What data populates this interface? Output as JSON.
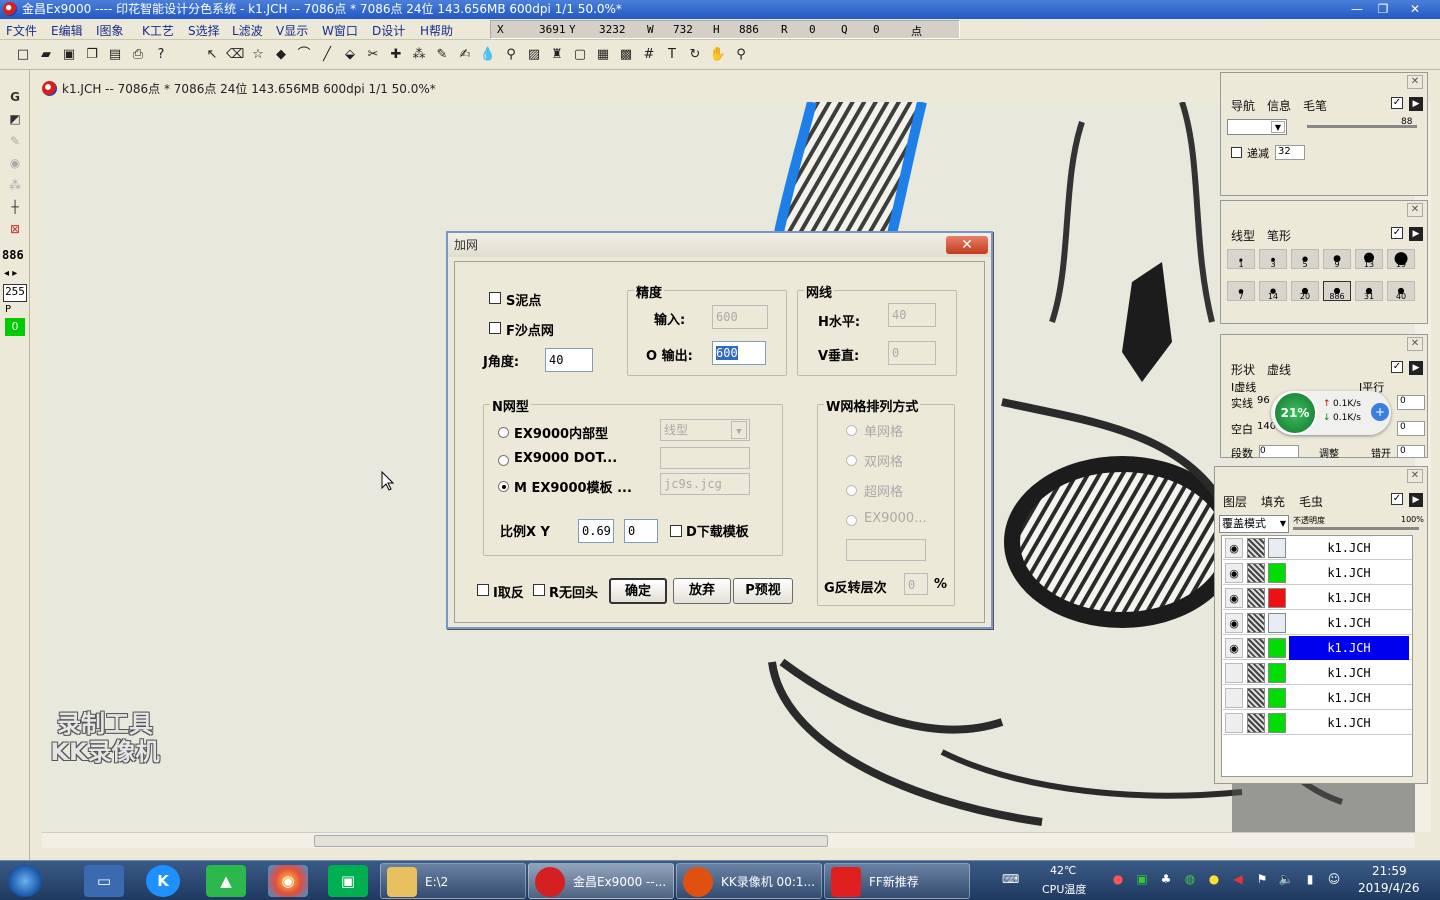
{
  "window": {
    "title": "金昌Ex9000 ---- 印花智能设计分色系统 - k1.JCH -- 7086点 * 7086点 24位 143.656MB 600dpi 1/1  50.0%*",
    "min": "—",
    "max": "❐",
    "close": "✕"
  },
  "menu": [
    "F文件",
    "E编辑",
    "I图象",
    "K工艺",
    "S选择",
    "L滤波",
    "V显示",
    "W窗口",
    "D设计",
    "H帮助"
  ],
  "coords": {
    "x_label": "X",
    "x": "3691",
    "y_label": "Y",
    "y": "3232",
    "w_label": "W",
    "w": "732",
    "h_label": "H",
    "h": "886",
    "r_label": "R",
    "r": "0",
    "q_label": "Q",
    "q": "0",
    "unit": "点"
  },
  "toolbox": {
    "g": "G",
    "num1": "886",
    "num2": "255",
    "tag": "P",
    "num3": "0"
  },
  "document": {
    "title": "k1.JCH -- 7086点 * 7086点 24位 143.656MB 600dpi 1/1  50.0%*"
  },
  "dialog": {
    "title": "加网",
    "close": "✕",
    "mud_dot": "S泥点",
    "sand_dot": "F沙点网",
    "angle_label": "J角度:",
    "angle_value": "40",
    "precision": {
      "title": "精度",
      "input_label": "输入:",
      "input_value": "600",
      "output_label": "O 输出:",
      "output_value": "600"
    },
    "screen_line": {
      "title": "网线",
      "h_label": "H水平:",
      "h_value": "40",
      "v_label": "V垂直:",
      "v_value": "0"
    },
    "net_type": {
      "title": "N网型",
      "opt1": "EX9000内部型",
      "opt1_select": "线型",
      "opt2": "EX9000 DOT...",
      "opt2_value": "",
      "opt3": "M EX9000模板 ...",
      "opt3_value": "jc9s.jcg"
    },
    "ratio_label": "比例X Y",
    "ratio_x": "0.69",
    "ratio_y": "0",
    "download_template": "D下载模板",
    "arrangement": {
      "title": "W网格排列方式",
      "opt1": "单网格",
      "opt2": "双网格",
      "opt3": "超网格",
      "opt4": "EX9000...",
      "value": ""
    },
    "invert_levels_label": "G反转层次",
    "invert_levels_value": "0",
    "invert_levels_unit": "%",
    "invert": "I取反",
    "no_return": "R无回头",
    "ok": "确定",
    "cancel": "放弃",
    "preview": "P预视"
  },
  "panels": {
    "nav": {
      "tabs": [
        "导航",
        "信息",
        "毛笔"
      ],
      "slider_value": "88",
      "checkbox": "递减",
      "checkbox_value": "32"
    },
    "brush": {
      "tabs": [
        "线型",
        "笔形"
      ],
      "sizes": [
        "1",
        "3",
        "5",
        "9",
        "13",
        "19",
        "7",
        "14",
        "20",
        "886",
        "31",
        "40"
      ]
    },
    "shape": {
      "tabs": [
        "形状",
        "虚线"
      ],
      "dashed": "I虚线",
      "parallel": "I平行",
      "solid_label": "实线",
      "solid_value": "96",
      "blank_label": "空白",
      "blank_value": "140",
      "segments_label": "段数",
      "segments_value": "0",
      "adjust": "调整",
      "stagger": "错开",
      "right_val1": "0",
      "right_val2": "0",
      "right_val3": "0",
      "cpu": "21%",
      "up_speed": "0.1K/s",
      "down_speed": "0.1K/s"
    },
    "layers": {
      "tabs": [
        "图层",
        "填充",
        "毛虫"
      ],
      "blend_mode": "覆盖模式",
      "opacity_label": "不透明度",
      "opacity_value": "100%",
      "rows": [
        {
          "name": "k1.JCH",
          "color": "#e8ecf4",
          "visible": true,
          "selected": false
        },
        {
          "name": "k1.JCH",
          "color": "#00dd00",
          "visible": true,
          "selected": false
        },
        {
          "name": "k1.JCH",
          "color": "#ee1111",
          "visible": true,
          "selected": false
        },
        {
          "name": "k1.JCH",
          "color": "#e8ecf4",
          "visible": true,
          "selected": false
        },
        {
          "name": "k1.JCH",
          "color": "#00dd00",
          "visible": true,
          "selected": true
        },
        {
          "name": "k1.JCH",
          "color": "#00dd00",
          "visible": false,
          "selected": false
        },
        {
          "name": "k1.JCH",
          "color": "#00dd00",
          "visible": false,
          "selected": false
        },
        {
          "name": "k1.JCH",
          "color": "#00dd00",
          "visible": false,
          "selected": false
        }
      ]
    }
  },
  "watermark": {
    "line1": "录制工具",
    "line2": "KK录像机"
  },
  "taskbar": {
    "tasks": [
      {
        "label": "E:\\2",
        "color": "#e8c060"
      },
      {
        "label": "金昌Ex9000 --...",
        "color": "#d42020"
      },
      {
        "label": "KK录像机 00:1...",
        "color": "#e05010"
      },
      {
        "label": "FF新推荐",
        "color": "#e02020"
      }
    ],
    "temp": "42℃",
    "temp_label": "CPU温度",
    "time": "21:59",
    "date": "2019/4/26"
  },
  "colors": {
    "selected_layer": "#0000ee",
    "accent_blue": "#2358c4"
  }
}
